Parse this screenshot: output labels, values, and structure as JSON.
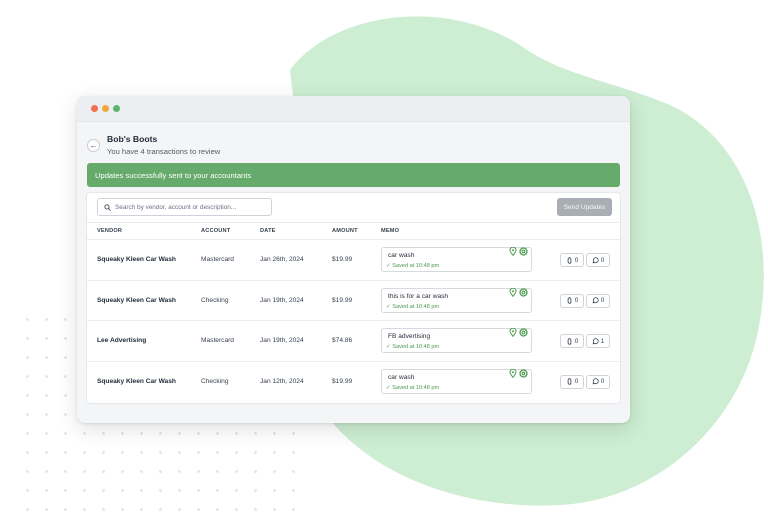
{
  "window": {
    "traffic_lights": [
      "#f0704d",
      "#f2a93b",
      "#5ab56b"
    ]
  },
  "header": {
    "title": "Bob's Boots",
    "subtitle": "You have 4 transactions to review"
  },
  "banner": {
    "text": "Updates successfully sent to your accountants",
    "color": "#66ab6b"
  },
  "toolbar": {
    "search_placeholder": "Search by vendor, account or description...",
    "send_label": "Send Updates"
  },
  "table": {
    "columns": [
      "VENDOR",
      "ACCOUNT",
      "DATE",
      "AMOUNT",
      "MEMO"
    ],
    "rows": [
      {
        "vendor": "Squeaky Kleen Car Wash",
        "account": "Mastercard",
        "date": "Jan 26th, 2024",
        "amount": "$19.99",
        "memo": "car wash",
        "saved": "✓ Saved at 10:48 pm",
        "attachments": "0",
        "comments": "0"
      },
      {
        "vendor": "Squeaky Kleen Car Wash",
        "account": "Checking",
        "date": "Jan 19th, 2024",
        "amount": "$19.99",
        "memo": "this is for a car wash",
        "saved": "✓ Saved at 10:48 pm",
        "attachments": "0",
        "comments": "0"
      },
      {
        "vendor": "Lee Advertising",
        "account": "Mastercard",
        "date": "Jan 19th, 2024",
        "amount": "$74.86",
        "memo": "FB advertising",
        "saved": "✓ Saved at 10:48 pm",
        "attachments": "0",
        "comments": "1"
      },
      {
        "vendor": "Squeaky Kleen Car Wash",
        "account": "Checking",
        "date": "Jan 12th, 2024",
        "amount": "$19.99",
        "memo": "car wash",
        "saved": "✓ Saved at 10:48 pm",
        "attachments": "0",
        "comments": "0"
      }
    ]
  },
  "icons": {
    "back": "arrow-left-icon",
    "search": "search-icon",
    "memo_pin": "location-pin-icon",
    "memo_brand": "brand-logo-icon",
    "attachment": "paperclip-icon",
    "comment": "comment-bubble-icon"
  },
  "colors": {
    "accent_green": "#4a9a4f",
    "blob_green": "#cdeed3",
    "disabled_button": "#a9adb4"
  }
}
